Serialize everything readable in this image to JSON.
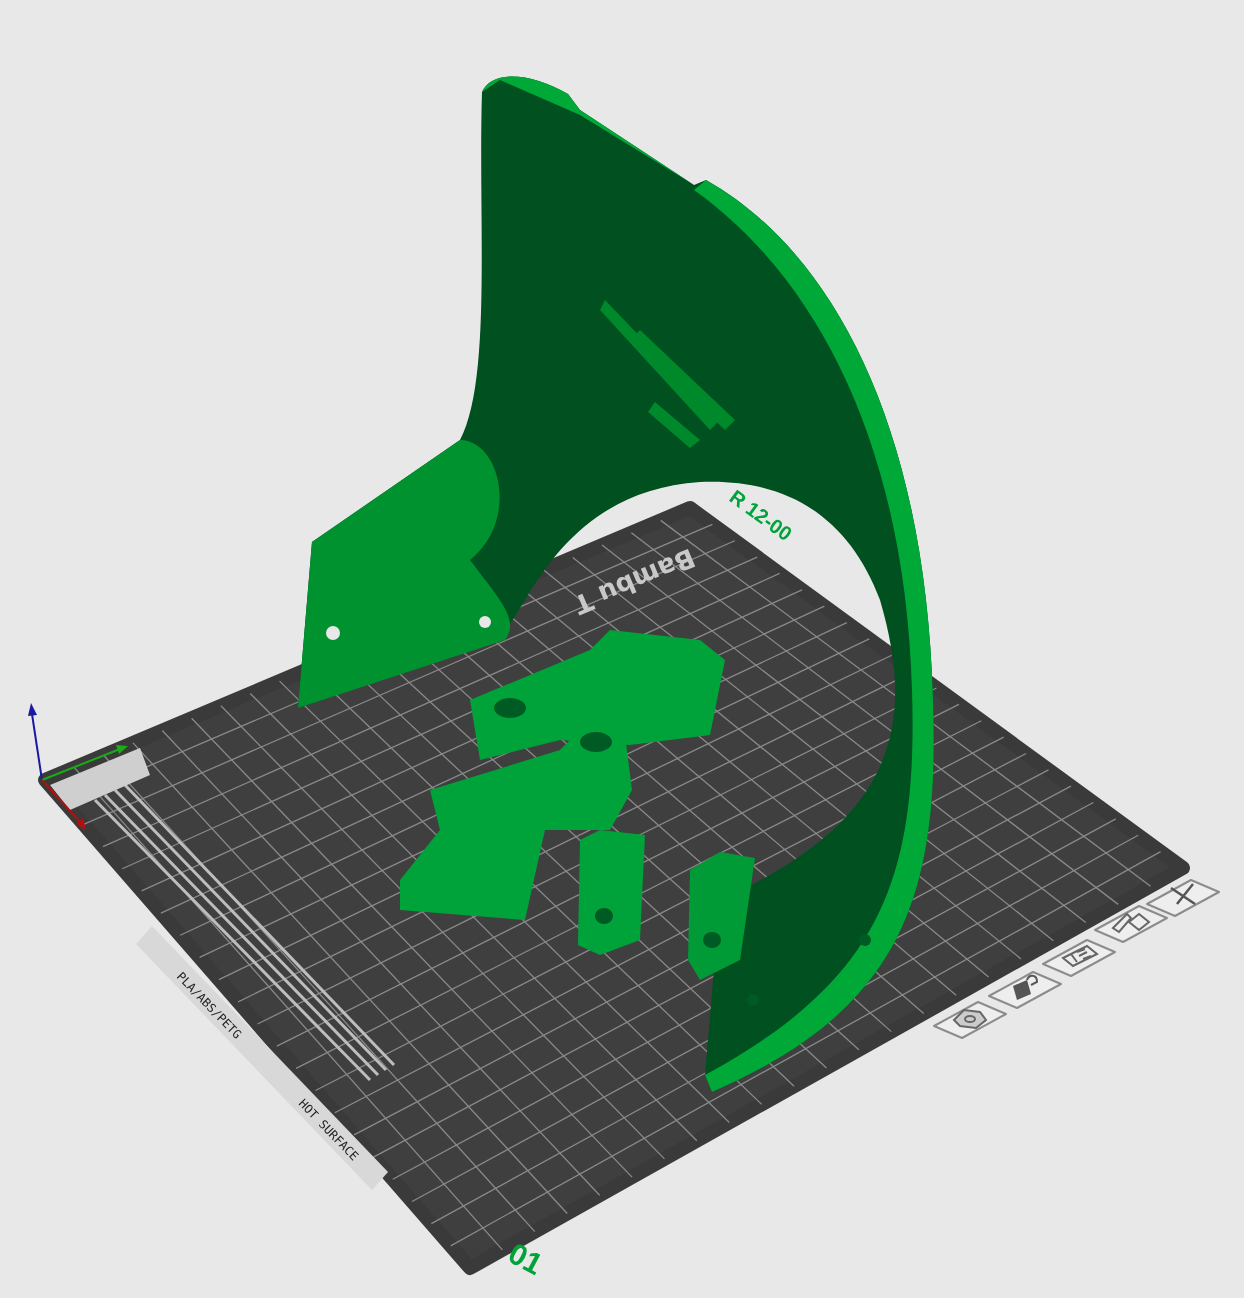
{
  "viewport": {
    "plate": {
      "number": "01",
      "brand_text": "Bambu T",
      "labels": [
        {
          "kind": "material",
          "text": "PLA/ABS/PETG"
        },
        {
          "kind": "warning",
          "text": "HOT SURFACE"
        }
      ]
    },
    "model": {
      "engraving": "R 12-00"
    },
    "plate_toolbar": [
      {
        "kind": "hexagon"
      },
      {
        "kind": "lock"
      },
      {
        "kind": "layout"
      },
      {
        "kind": "folder"
      },
      {
        "kind": "close"
      }
    ]
  }
}
